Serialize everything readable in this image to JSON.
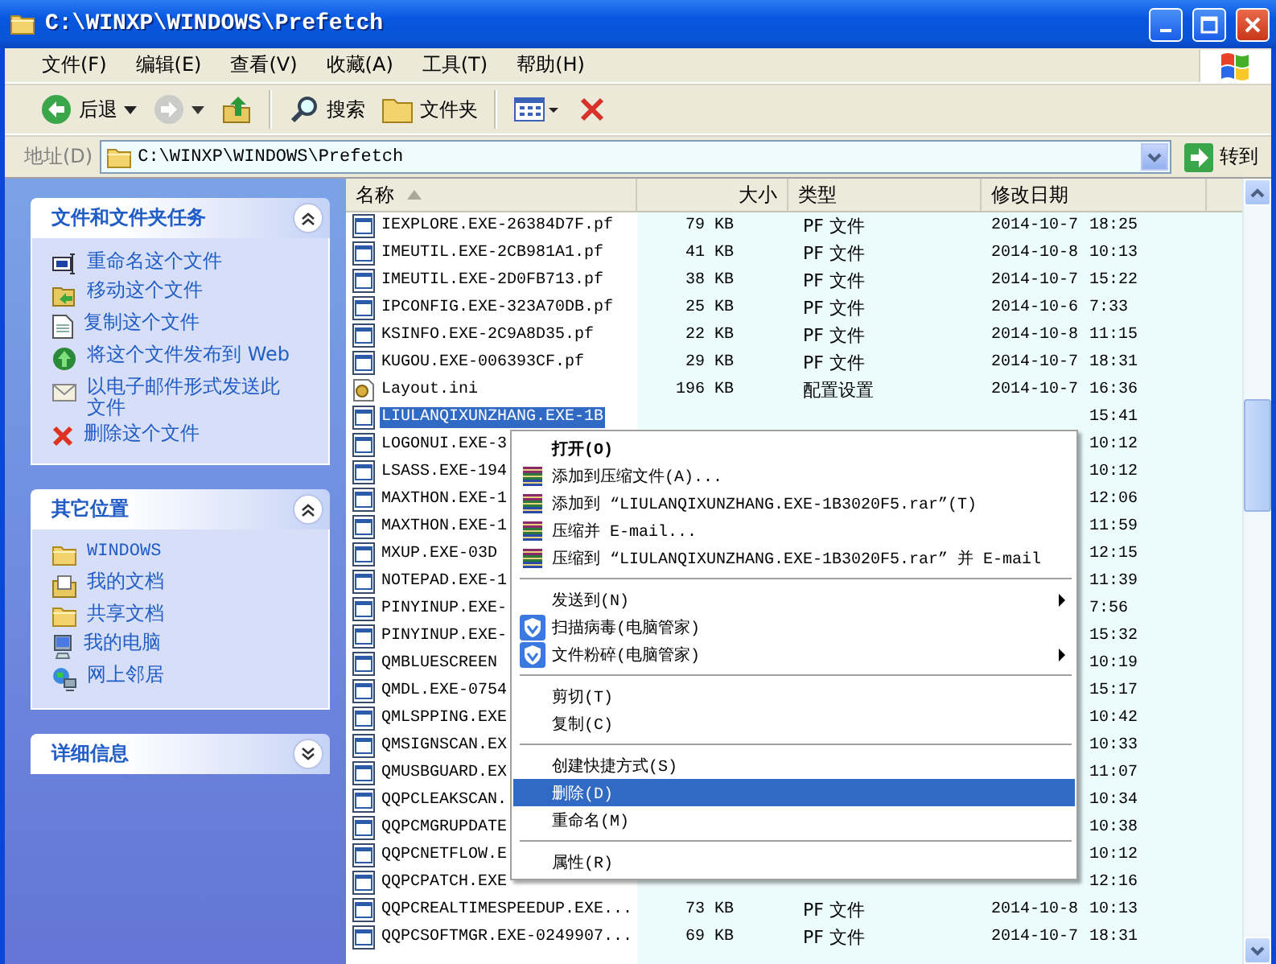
{
  "window": {
    "title": "C:\\WINXP\\WINDOWS\\Prefetch"
  },
  "menubar": [
    "文件(F)",
    "编辑(E)",
    "查看(V)",
    "收藏(A)",
    "工具(T)",
    "帮助(H)"
  ],
  "toolbar": [
    {
      "kind": "back",
      "label": "后退",
      "disabled": false
    },
    {
      "kind": "forward",
      "disabled": true
    },
    {
      "kind": "up",
      "disabled": false
    },
    {
      "kind": "separator"
    },
    {
      "kind": "search",
      "label": "搜索",
      "disabled": false
    },
    {
      "kind": "folders",
      "label": "文件夹",
      "disabled": false
    },
    {
      "kind": "separator"
    },
    {
      "kind": "views",
      "disabled": false
    },
    {
      "kind": "delete",
      "disabled": false
    }
  ],
  "address": {
    "label": "地址(D)",
    "value": "C:\\WINXP\\WINDOWS\\Prefetch",
    "go": "转到"
  },
  "sidebar": [
    {
      "title": "文件和文件夹任务",
      "expanded": true,
      "items": [
        {
          "label": "重命名这个文件",
          "kind": "rename"
        },
        {
          "label": "移动这个文件",
          "kind": "move"
        },
        {
          "label": "复制这个文件",
          "kind": "copy"
        },
        {
          "label": "将这个文件发布到 Web",
          "kind": "publish"
        },
        {
          "label": "以电子邮件形式发送此文件",
          "kind": "email"
        },
        {
          "label": "删除这个文件",
          "kind": "delete"
        }
      ]
    },
    {
      "title": "其它位置",
      "expanded": true,
      "items": [
        {
          "label": "WINDOWS",
          "kind": "folder"
        },
        {
          "label": "我的文档",
          "kind": "documents"
        },
        {
          "label": "共享文档",
          "kind": "folder"
        },
        {
          "label": "我的电脑",
          "kind": "computer"
        },
        {
          "label": "网上邻居",
          "kind": "network"
        }
      ]
    },
    {
      "title": "详细信息",
      "expanded": false
    }
  ],
  "table": {
    "columns": [
      {
        "label": "名称",
        "sorted": true
      },
      {
        "label": "大小",
        "sorted": false
      },
      {
        "label": "类型",
        "sorted": false
      },
      {
        "label": "修改日期",
        "sorted": false
      }
    ],
    "rows": [
      {
        "name": "IEXPLORE.EXE-26384D7F.pf",
        "kind": "pf",
        "size": "79 KB",
        "type": "PF 文件",
        "date": "2014-10-7",
        "time": "18:25",
        "selected": false
      },
      {
        "name": "IMEUTIL.EXE-2CB981A1.pf",
        "kind": "pf",
        "size": "41 KB",
        "type": "PF 文件",
        "date": "2014-10-8",
        "time": "10:13",
        "selected": false
      },
      {
        "name": "IMEUTIL.EXE-2D0FB713.pf",
        "kind": "pf",
        "size": "38 KB",
        "type": "PF 文件",
        "date": "2014-10-7",
        "time": "15:22",
        "selected": false
      },
      {
        "name": "IPCONFIG.EXE-323A70DB.pf",
        "kind": "pf",
        "size": "25 KB",
        "type": "PF 文件",
        "date": "2014-10-6",
        "time": "7:33",
        "selected": false
      },
      {
        "name": "KSINFO.EXE-2C9A8D35.pf",
        "kind": "pf",
        "size": "22 KB",
        "type": "PF 文件",
        "date": "2014-10-8",
        "time": "11:15",
        "selected": false
      },
      {
        "name": "KUGOU.EXE-006393CF.pf",
        "kind": "pf",
        "size": "29 KB",
        "type": "PF 文件",
        "date": "2014-10-7",
        "time": "18:31",
        "selected": false
      },
      {
        "name": "Layout.ini",
        "kind": "ini",
        "size": "196 KB",
        "type": "配置设置",
        "date": "2014-10-7",
        "time": "16:36",
        "selected": false
      },
      {
        "name": "LIULANQIXUNZHANG.EXE-1B",
        "kind": "pf",
        "time": "15:41",
        "selected": true
      },
      {
        "name": "LOGONUI.EXE-3",
        "kind": "pf",
        "time": "10:12",
        "selected": false
      },
      {
        "name": "LSASS.EXE-194",
        "kind": "pf",
        "time": "10:12",
        "selected": false
      },
      {
        "name": "MAXTHON.EXE-1",
        "kind": "pf",
        "time": "12:06",
        "selected": false
      },
      {
        "name": "MAXTHON.EXE-1",
        "kind": "pf",
        "time": "11:59",
        "selected": false
      },
      {
        "name": "MXUP.EXE-03D",
        "kind": "pf",
        "time": "12:15",
        "selected": false
      },
      {
        "name": "NOTEPAD.EXE-1",
        "kind": "pf",
        "time": "11:39",
        "selected": false
      },
      {
        "name": "PINYINUP.EXE-",
        "kind": "pf",
        "time": "7:56",
        "selected": false
      },
      {
        "name": "PINYINUP.EXE-",
        "kind": "pf",
        "time": "15:32",
        "selected": false
      },
      {
        "name": "QMBLUESCREEN",
        "kind": "pf",
        "time": "10:19",
        "selected": false
      },
      {
        "name": "QMDL.EXE-0754",
        "kind": "pf",
        "time": "15:17",
        "selected": false
      },
      {
        "name": "QMLSPPING.EXE",
        "kind": "pf",
        "time": "10:42",
        "selected": false
      },
      {
        "name": "QMSIGNSCAN.EX",
        "kind": "pf",
        "time": "10:33",
        "selected": false
      },
      {
        "name": "QMUSBGUARD.EX",
        "kind": "pf",
        "time": "11:07",
        "selected": false
      },
      {
        "name": "QQPCLEAKSCAN.",
        "kind": "pf",
        "time": "10:34",
        "selected": false
      },
      {
        "name": "QQPCMGRUPDATE",
        "kind": "pf",
        "time": "10:38",
        "selected": false
      },
      {
        "name": "QQPCNETFLOW.E",
        "kind": "pf",
        "time": "10:12",
        "selected": false
      },
      {
        "name": "QQPCPATCH.EXE",
        "kind": "pf",
        "time": "12:16",
        "selected": false
      },
      {
        "name": "QQPCREALTIMESPEEDUP.EXE...",
        "kind": "pf",
        "size": "73 KB",
        "type": "PF 文件",
        "date": "2014-10-8",
        "time": "10:13",
        "selected": false
      },
      {
        "name": "QQPCSOFTMGR.EXE-0249907...",
        "kind": "pf",
        "size": "69 KB",
        "type": "PF 文件",
        "date": "2014-10-7",
        "time": "18:31",
        "selected": false
      }
    ]
  },
  "context_menu": {
    "items": [
      {
        "kind": "command",
        "label": "打开(O)",
        "default": true,
        "submenu": false,
        "selected": false
      },
      {
        "kind": "archive_command",
        "label": "添加到压缩文件(A)...",
        "default": false,
        "submenu": false,
        "selected": false
      },
      {
        "kind": "archive_command",
        "label": "添加到 “LIULANQIXUNZHANG.EXE-1B3020F5.rar”(T)",
        "default": false,
        "submenu": false,
        "selected": false
      },
      {
        "kind": "archive_command",
        "label": "压缩并 E-mail...",
        "default": false,
        "submenu": false,
        "selected": false
      },
      {
        "kind": "archive_command",
        "label": "压缩到 “LIULANQIXUNZHANG.EXE-1B3020F5.rar” 并 E-mail",
        "default": false,
        "submenu": false,
        "selected": false
      },
      {
        "kind": "separator"
      },
      {
        "kind": "command",
        "label": "发送到(N)",
        "default": false,
        "submenu": true,
        "selected": false
      },
      {
        "kind": "shield_command",
        "label": "扫描病毒(电脑管家)",
        "default": false,
        "submenu": false,
        "selected": false
      },
      {
        "kind": "shield_command",
        "label": "文件粉碎(电脑管家)",
        "default": false,
        "submenu": true,
        "selected": false
      },
      {
        "kind": "separator"
      },
      {
        "kind": "command",
        "label": "剪切(T)",
        "default": false,
        "submenu": false,
        "selected": false
      },
      {
        "kind": "command",
        "label": "复制(C)",
        "default": false,
        "submenu": false,
        "selected": false
      },
      {
        "kind": "separator"
      },
      {
        "kind": "command",
        "label": "创建快捷方式(S)",
        "default": false,
        "submenu": false,
        "selected": false
      },
      {
        "kind": "command",
        "label": "删除(D)",
        "default": false,
        "submenu": false,
        "selected": true
      },
      {
        "kind": "command",
        "label": "重命名(M)",
        "default": false,
        "submenu": false,
        "selected": false
      },
      {
        "kind": "separator"
      },
      {
        "kind": "command",
        "label": "属性(R)",
        "default": false,
        "submenu": false,
        "selected": false
      }
    ]
  }
}
